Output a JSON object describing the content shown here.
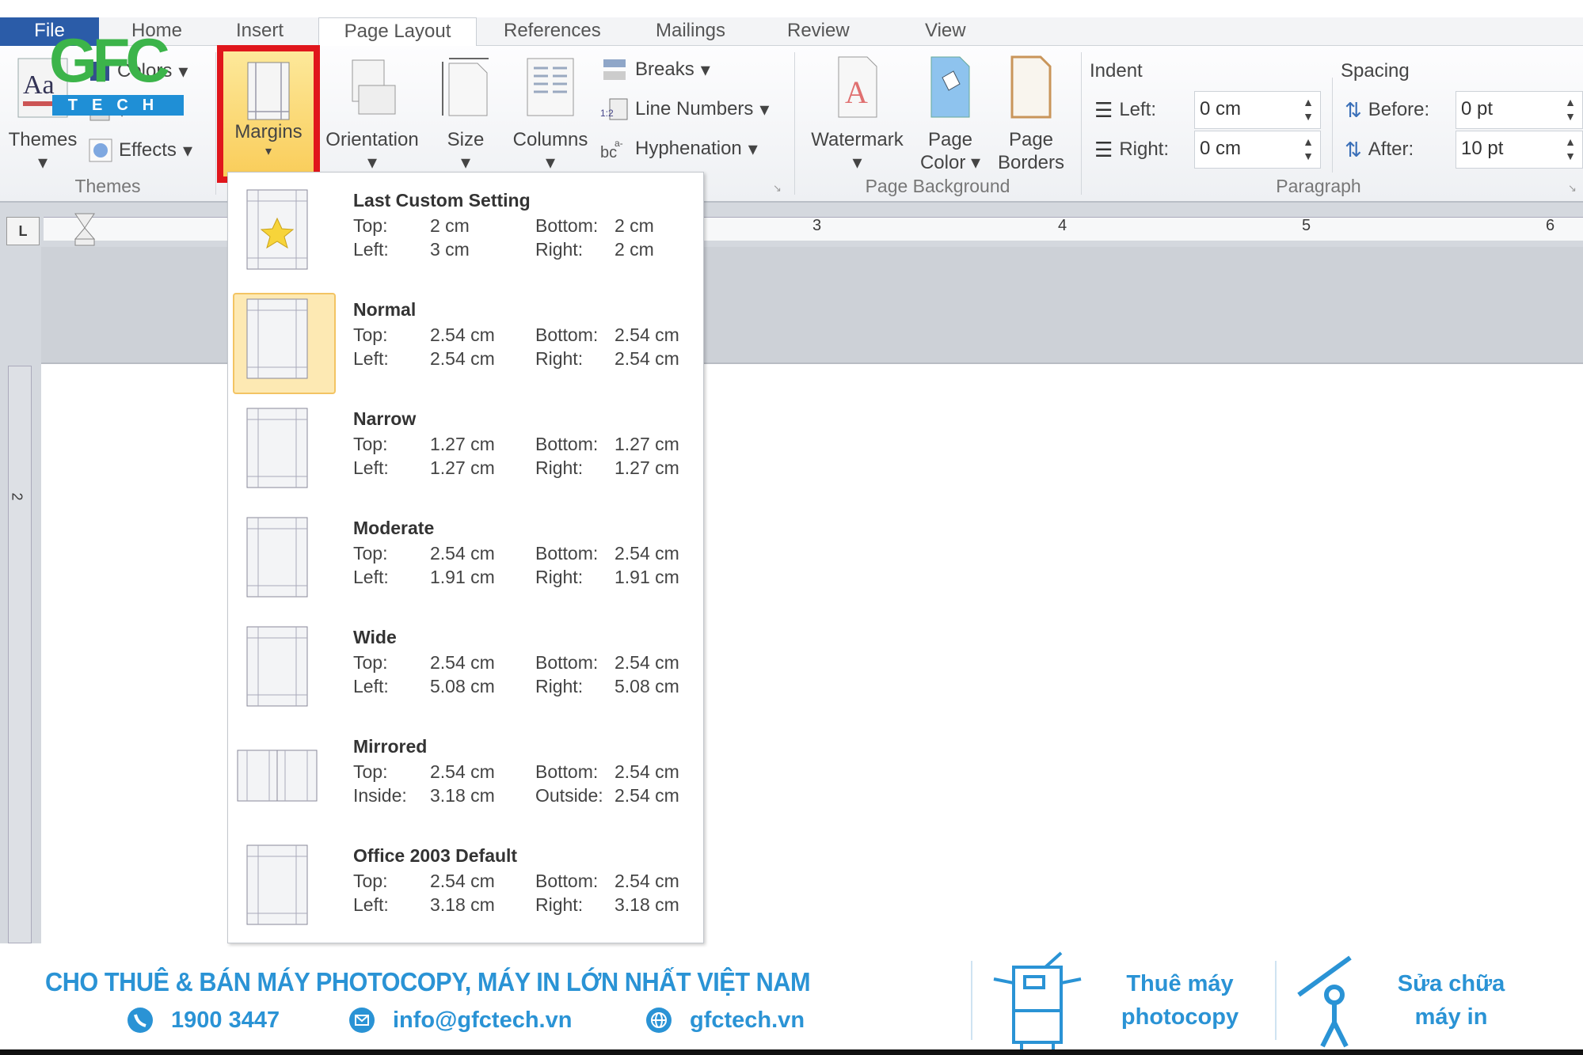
{
  "tabs": [
    {
      "label": "File"
    },
    {
      "label": "Home"
    },
    {
      "label": "Insert"
    },
    {
      "label": "Page Layout"
    },
    {
      "label": "References"
    },
    {
      "label": "Mailings"
    },
    {
      "label": "Review"
    },
    {
      "label": "View"
    }
  ],
  "ribbon": {
    "themes": {
      "themes_label": "Themes",
      "colors_label": "Colors",
      "effects_label": "Effects",
      "group_label": "Themes"
    },
    "page_setup": {
      "margins": "Margins",
      "orientation": "Orientation",
      "size": "Size",
      "columns": "Columns",
      "breaks": "Breaks",
      "line_numbers": "Line Numbers",
      "hyphenation": "Hyphenation"
    },
    "page_background": {
      "watermark": "Watermark",
      "page_color_1": "Page",
      "page_color_2": "Color",
      "page_borders_1": "Page",
      "page_borders_2": "Borders",
      "group_label": "Page Background"
    },
    "paragraph": {
      "indent_label": "Indent",
      "left_label": "Left:",
      "left_value": "0 cm",
      "right_label": "Right:",
      "right_value": "0 cm",
      "spacing_label": "Spacing",
      "before_label": "Before:",
      "before_value": "0 pt",
      "after_label": "After:",
      "after_value": "10 pt",
      "group_label": "Paragraph"
    }
  },
  "ruler": {
    "numbers": [
      "3",
      "4",
      "5",
      "6"
    ],
    "vertical_number": "2"
  },
  "logo": {
    "text": "GFC",
    "sub": "TECH"
  },
  "margins_menu": [
    {
      "title": "Last Custom Setting",
      "l1": "Top:",
      "v1": "2 cm",
      "l2": "Bottom:",
      "v2": "2 cm",
      "l3": "Left:",
      "v3": "3 cm",
      "l4": "Right:",
      "v4": "2 cm",
      "icon": "star"
    },
    {
      "title": "Normal",
      "l1": "Top:",
      "v1": "2.54 cm",
      "l2": "Bottom:",
      "v2": "2.54 cm",
      "l3": "Left:",
      "v3": "2.54 cm",
      "l4": "Right:",
      "v4": "2.54 cm",
      "selected": true
    },
    {
      "title": "Narrow",
      "l1": "Top:",
      "v1": "1.27 cm",
      "l2": "Bottom:",
      "v2": "1.27 cm",
      "l3": "Left:",
      "v3": "1.27 cm",
      "l4": "Right:",
      "v4": "1.27 cm"
    },
    {
      "title": "Moderate",
      "l1": "Top:",
      "v1": "2.54 cm",
      "l2": "Bottom:",
      "v2": "2.54 cm",
      "l3": "Left:",
      "v3": "1.91 cm",
      "l4": "Right:",
      "v4": "1.91 cm"
    },
    {
      "title": "Wide",
      "l1": "Top:",
      "v1": "2.54 cm",
      "l2": "Bottom:",
      "v2": "2.54 cm",
      "l3": "Left:",
      "v3": "5.08 cm",
      "l4": "Right:",
      "v4": "5.08 cm"
    },
    {
      "title": "Mirrored",
      "l1": "Top:",
      "v1": "2.54 cm",
      "l2": "Bottom:",
      "v2": "2.54 cm",
      "l3": "Inside:",
      "v3": "3.18 cm",
      "l4": "Outside:",
      "v4": "2.54 cm",
      "icon": "mirrored"
    },
    {
      "title": "Office 2003 Default",
      "l1": "Top:",
      "v1": "2.54 cm",
      "l2": "Bottom:",
      "v2": "2.54 cm",
      "l3": "Left:",
      "v3": "3.18 cm",
      "l4": "Right:",
      "v4": "3.18 cm"
    }
  ],
  "footer": {
    "headline": "CHO THUÊ & BÁN MÁY PHOTOCOPY, MÁY IN LỚN NHẤT VIỆT NAM",
    "phone": "1900 3447",
    "email": "info@gfctech.vn",
    "website": "gfctech.vn",
    "service1_l1": "Thuê máy",
    "service1_l2": "photocopy",
    "service2_l1": "Sửa chữa",
    "service2_l2": "máy in"
  },
  "colors": {
    "file_tab": "#2b5ca8",
    "highlight_box": "#e0161c",
    "footer_blue": "#2a93d5",
    "logo_green": "#3cb44a"
  }
}
